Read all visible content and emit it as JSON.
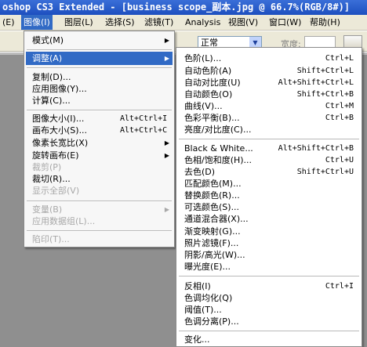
{
  "window": {
    "title": "oshop CS3 Extended - [business scope_副本.jpg @ 66.7%(RGB/8#)]"
  },
  "menubar": {
    "items": [
      "(E)",
      "图像(I)",
      "图层(L)",
      "选择(S)",
      "滤镜(T)",
      "Analysis",
      "视图(V)",
      "窗口(W)",
      "帮助(H)"
    ]
  },
  "options": {
    "mode_value": "正常",
    "width_label": "宽度:"
  },
  "image_menu": {
    "items": [
      {
        "label": "模式(M)",
        "submenu": "▶"
      },
      {
        "label": "调整(A)",
        "submenu": "▶"
      },
      {
        "label": "复制(D)..."
      },
      {
        "label": "应用图像(Y)..."
      },
      {
        "label": "计算(C)..."
      },
      {
        "label": "图像大小(I)...",
        "shortcut": "Alt+Ctrl+I"
      },
      {
        "label": "画布大小(S)...",
        "shortcut": "Alt+Ctrl+C"
      },
      {
        "label": "像素长宽比(X)",
        "submenu": "▶"
      },
      {
        "label": "旋转画布(E)",
        "submenu": "▶"
      },
      {
        "label": "裁剪(P)"
      },
      {
        "label": "裁切(R)..."
      },
      {
        "label": "显示全部(V)"
      },
      {
        "label": "变量(B)",
        "submenu": "▶"
      },
      {
        "label": "应用数据组(L)..."
      },
      {
        "label": "陷印(T)..."
      }
    ]
  },
  "adjust_menu": {
    "items": [
      {
        "label": "色阶(L)...",
        "shortcut": "Ctrl+L"
      },
      {
        "label": "自动色阶(A)",
        "shortcut": "Shift+Ctrl+L"
      },
      {
        "label": "自动对比度(U)",
        "shortcut": "Alt+Shift+Ctrl+L"
      },
      {
        "label": "自动颜色(O)",
        "shortcut": "Shift+Ctrl+B"
      },
      {
        "label": "曲线(V)...",
        "shortcut": "Ctrl+M"
      },
      {
        "label": "色彩平衡(B)...",
        "shortcut": "Ctrl+B"
      },
      {
        "label": "亮度/对比度(C)..."
      },
      {
        "label": "Black & White...",
        "shortcut": "Alt+Shift+Ctrl+B"
      },
      {
        "label": "色相/饱和度(H)...",
        "shortcut": "Ctrl+U"
      },
      {
        "label": "去色(D)",
        "shortcut": "Shift+Ctrl+U"
      },
      {
        "label": "匹配颜色(M)..."
      },
      {
        "label": "替换颜色(R)..."
      },
      {
        "label": "可选颜色(S)..."
      },
      {
        "label": "通道混合器(X)..."
      },
      {
        "label": "渐变映射(G)..."
      },
      {
        "label": "照片滤镜(F)..."
      },
      {
        "label": "阴影/高光(W)..."
      },
      {
        "label": "曝光度(E)..."
      },
      {
        "label": "反相(I)",
        "shortcut": "Ctrl+I"
      },
      {
        "label": "色调均化(Q)"
      },
      {
        "label": "阈值(T)..."
      },
      {
        "label": "色调分离(P)..."
      },
      {
        "label": "变化..."
      }
    ]
  },
  "colors": {
    "highlight": "#316ac5",
    "titlebar": "#1d4fbf",
    "menubar": "#ece9d8",
    "canvas": "#8f8f8f",
    "disabled": "#a8a8a8"
  }
}
